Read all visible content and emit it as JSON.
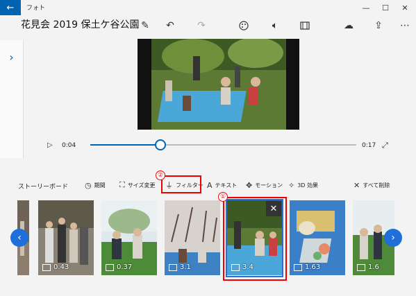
{
  "window": {
    "app_title": "フォト",
    "back_icon": "back-arrow-icon",
    "controls": {
      "minimize": "—",
      "maximize": "☐",
      "close": "✕"
    }
  },
  "header": {
    "project_title": "花見会 2019 保土ケ谷公園",
    "icons": [
      "edit-icon",
      "undo-icon",
      "redo-icon",
      "palette-icon",
      "audio-icon",
      "aspect-ratio-icon",
      "export-icon",
      "share-icon",
      "more-icon"
    ]
  },
  "playback": {
    "current_time": "0:04",
    "total_time": "0:17",
    "progress": 0.265
  },
  "storyboard": {
    "label": "ストーリーボード",
    "tools": [
      {
        "id": "duration",
        "label": "期間",
        "icon": "clock-icon",
        "glyph": "◷"
      },
      {
        "id": "resize",
        "label": "サイズ変更",
        "icon": "resize-icon",
        "glyph": "⛶"
      },
      {
        "id": "filter",
        "label": "フィルター",
        "icon": "filter-icon",
        "glyph": "⏚"
      },
      {
        "id": "text",
        "label": "テキスト",
        "icon": "text-icon",
        "glyph": "A"
      },
      {
        "id": "motion",
        "label": "モーション",
        "icon": "motion-icon",
        "glyph": "✥"
      },
      {
        "id": "effects3d",
        "label": "3D 効果",
        "icon": "3d-effects-icon",
        "glyph": "✧"
      },
      {
        "id": "remove_all",
        "label": "すべて削除",
        "icon": "close-icon",
        "glyph": "✕"
      }
    ],
    "markers": {
      "selected_clip": "①",
      "filter_tool": "②"
    },
    "clips": [
      {
        "duration": "",
        "scene": "crowd"
      },
      {
        "duration": "0.43",
        "scene": "crowd"
      },
      {
        "duration": "0.37",
        "scene": "picnic"
      },
      {
        "duration": "3.1",
        "scene": "blossom"
      },
      {
        "duration": "3.4",
        "scene": "park",
        "selected": true
      },
      {
        "duration": "1.63",
        "scene": "food"
      },
      {
        "duration": "1.6",
        "scene": "picnic"
      }
    ]
  },
  "colors": {
    "accent": "#0063b1",
    "highlight": "#e00000",
    "selection": "#2b6fd6"
  }
}
